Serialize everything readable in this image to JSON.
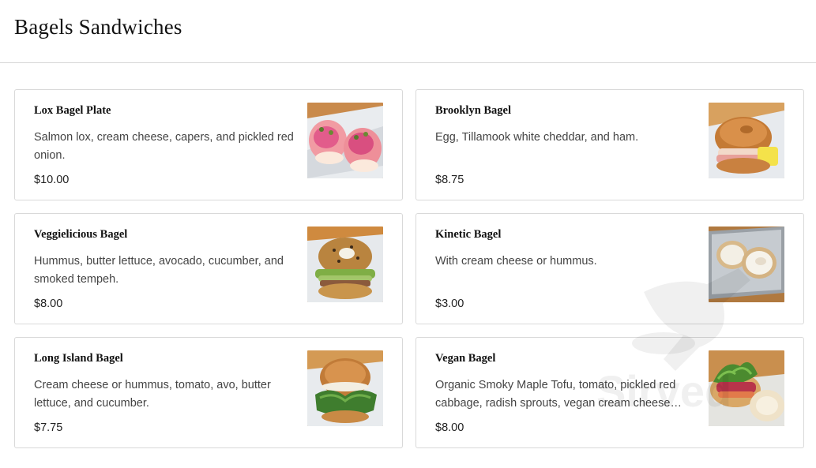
{
  "page": {
    "title": "Bagels Sandwiches"
  },
  "items": [
    {
      "name": "Lox Bagel Plate",
      "description": "Salmon lox, cream cheese, capers, and pickled red onion.",
      "price": "$10.00"
    },
    {
      "name": "Brooklyn Bagel",
      "description": "Egg, Tillamook white cheddar, and ham.",
      "price": "$8.75"
    },
    {
      "name": "Veggielicious Bagel",
      "description": "Hummus, butter lettuce, avocado, cucumber, and smoked tempeh.",
      "price": "$8.00"
    },
    {
      "name": "Kinetic Bagel",
      "description": "With cream cheese or hummus.",
      "price": "$3.00"
    },
    {
      "name": "Long Island Bagel",
      "description": "Cream cheese or hummus, tomato, avo, butter lettuce, and cucumber.",
      "price": "$7.75"
    },
    {
      "name": "Vegan Bagel",
      "description": "Organic Smoky Maple Tofu, tomato, pickled red cabbage, radish sprouts, vegan cream cheese on…",
      "price": "$8.00"
    }
  ],
  "watermark": {
    "text": "Sirved",
    "icon": "fork-knife-icon"
  },
  "colors": {
    "border": "#d9d9d9",
    "divider": "#d6d6d6",
    "title": "#111111",
    "text": "#444444"
  }
}
